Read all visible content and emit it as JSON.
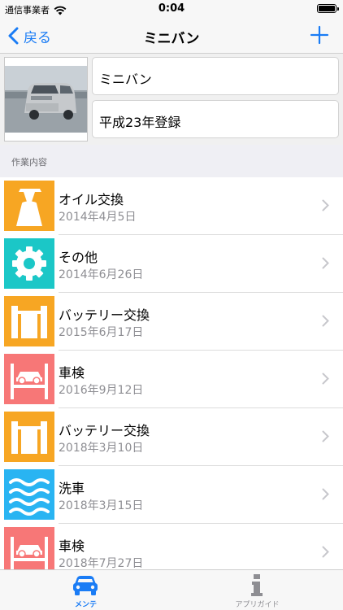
{
  "status_bar": {
    "carrier": "通信事業者",
    "time": "0:04"
  },
  "nav": {
    "back_label": "戻る",
    "title": "ミニバン",
    "add_icon": "plus-icon"
  },
  "vehicle": {
    "name": "ミニバン",
    "registration": "平成23年登録"
  },
  "section": {
    "title": "作業内容"
  },
  "records": [
    {
      "title": "オイル交換",
      "date": "2014年4月5日",
      "icon": "oil-can-icon",
      "color": "#f7a623"
    },
    {
      "title": "その他",
      "date": "2014年6月26日",
      "icon": "gear-icon",
      "color": "#1bc7c7"
    },
    {
      "title": "バッテリー交換",
      "date": "2015年6月17日",
      "icon": "battery-icon",
      "color": "#f7a623"
    },
    {
      "title": "車検",
      "date": "2016年9月12日",
      "icon": "car-lift-icon",
      "color": "#f77777"
    },
    {
      "title": "バッテリー交換",
      "date": "2018年3月10日",
      "icon": "battery-icon",
      "color": "#f7a623"
    },
    {
      "title": "洗車",
      "date": "2018年3月15日",
      "icon": "water-waves-icon",
      "color": "#29b4f2"
    },
    {
      "title": "車検",
      "date": "2018年7月27日",
      "icon": "car-lift-icon",
      "color": "#f77777"
    }
  ],
  "tabs": [
    {
      "label": "メンテ",
      "icon": "car-icon",
      "active": true
    },
    {
      "label": "アプリガイド",
      "icon": "info-icon",
      "active": false
    }
  ],
  "colors": {
    "accent": "#1a7cf5",
    "orange": "#f7a623",
    "teal": "#1bc7c7",
    "red": "#f77777",
    "blue": "#29b4f2"
  }
}
